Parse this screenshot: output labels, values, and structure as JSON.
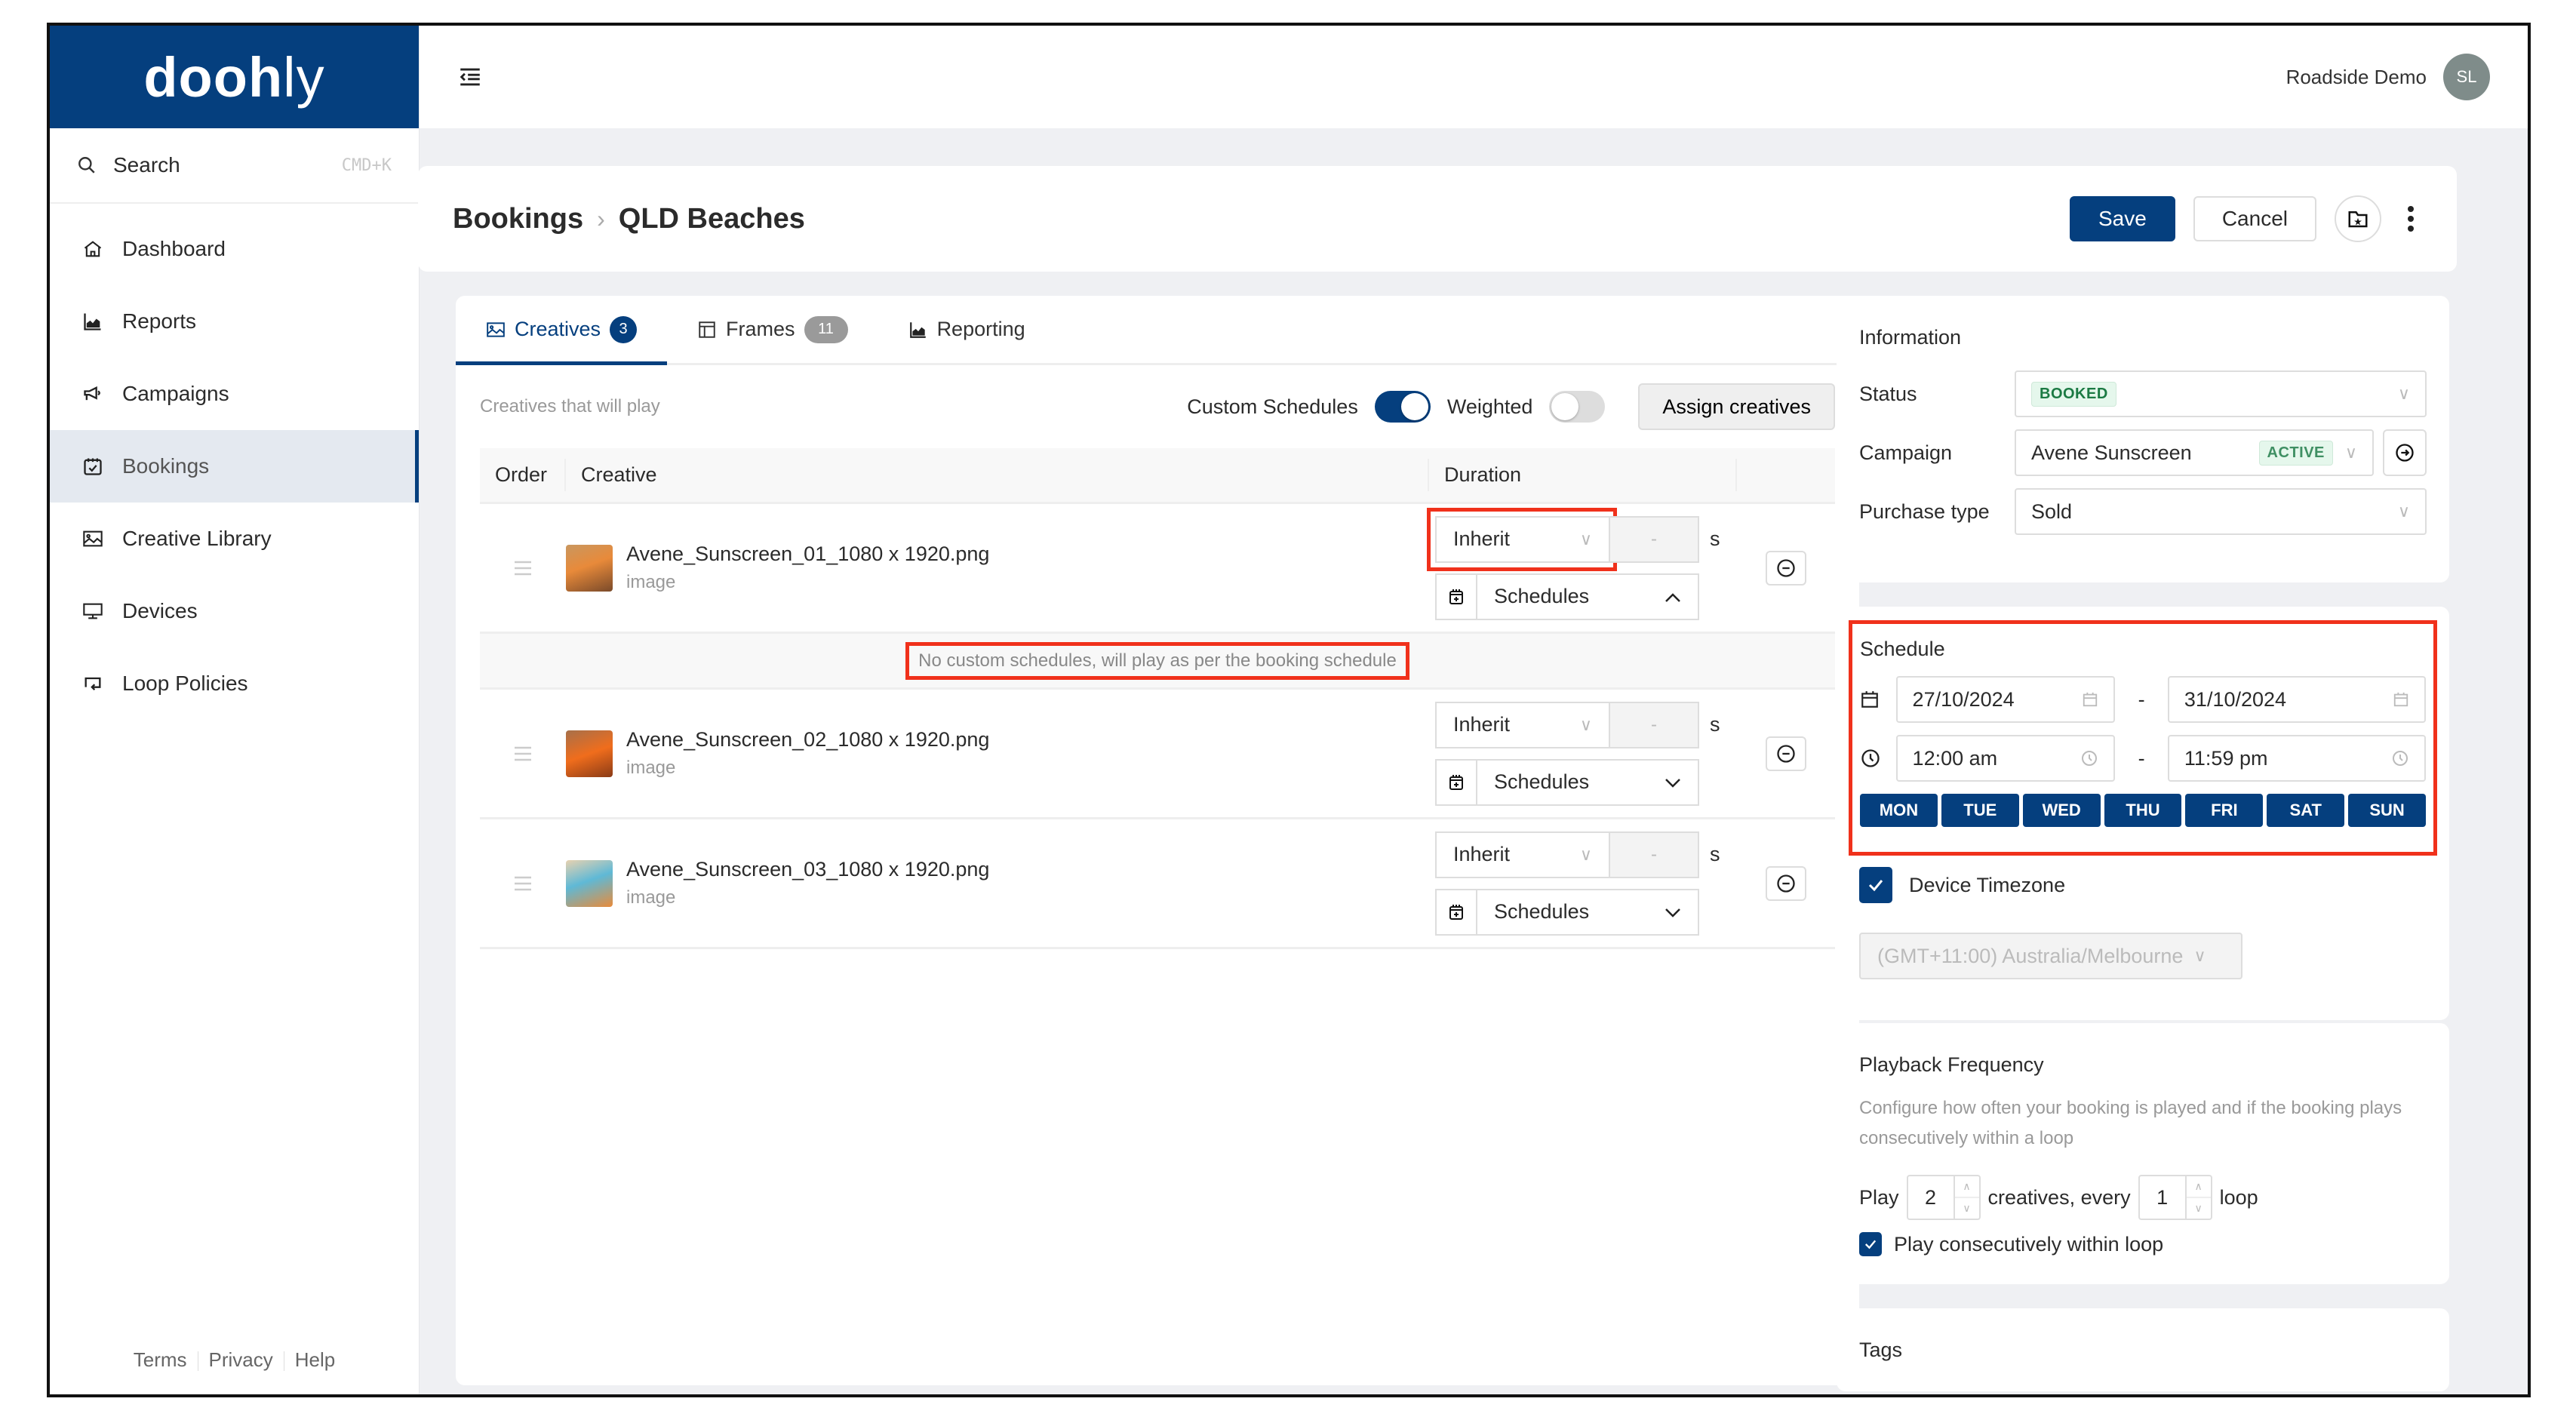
{
  "app": {
    "logo_bold": "dooh",
    "logo_light": "ly"
  },
  "sidebar": {
    "search": {
      "label": "Search",
      "shortcut": "CMD+K"
    },
    "items": [
      {
        "label": "Dashboard",
        "icon": "home-icon",
        "active": false
      },
      {
        "label": "Reports",
        "icon": "chart-icon",
        "active": false
      },
      {
        "label": "Campaigns",
        "icon": "megaphone-icon",
        "active": false
      },
      {
        "label": "Bookings",
        "icon": "calendar-check-icon",
        "active": true
      },
      {
        "label": "Creative Library",
        "icon": "image-icon",
        "active": false
      },
      {
        "label": "Devices",
        "icon": "monitor-icon",
        "active": false
      },
      {
        "label": "Loop Policies",
        "icon": "loop-icon",
        "active": false
      }
    ],
    "footer": {
      "terms": "Terms",
      "privacy": "Privacy",
      "help": "Help"
    }
  },
  "topbar": {
    "account_name": "Roadside Demo",
    "avatar_initials": "SL"
  },
  "header": {
    "breadcrumb": [
      "Bookings",
      "QLD Beaches"
    ],
    "save_label": "Save",
    "cancel_label": "Cancel"
  },
  "tabs": [
    {
      "label": "Creatives",
      "count": "3",
      "active": true
    },
    {
      "label": "Frames",
      "count": "11",
      "active": false
    },
    {
      "label": "Reporting",
      "count": null,
      "active": false
    }
  ],
  "creatives": {
    "hint": "Creatives that will play",
    "custom_schedules_label": "Custom Schedules",
    "custom_schedules_on": true,
    "weighted_label": "Weighted",
    "weighted_on": false,
    "assign_label": "Assign creatives",
    "columns": {
      "order": "Order",
      "creative": "Creative",
      "duration": "Duration"
    },
    "rows": [
      {
        "name": "Avene_Sunscreen_01_1080 x 1920.png",
        "type": "image",
        "duration_mode": "Inherit",
        "duration_value": "-",
        "unit": "s",
        "schedules_label": "Schedules",
        "expanded": true
      },
      {
        "name": "Avene_Sunscreen_02_1080 x 1920.png",
        "type": "image",
        "duration_mode": "Inherit",
        "duration_value": "-",
        "unit": "s",
        "schedules_label": "Schedules",
        "expanded": false
      },
      {
        "name": "Avene_Sunscreen_03_1080 x 1920.png",
        "type": "image",
        "duration_mode": "Inherit",
        "duration_value": "-",
        "unit": "s",
        "schedules_label": "Schedules",
        "expanded": false
      }
    ],
    "no_schedule_note": "No custom schedules, will play as per the booking schedule"
  },
  "information": {
    "title": "Information",
    "status_label": "Status",
    "status_value": "BOOKED",
    "campaign_label": "Campaign",
    "campaign_value": "Avene Sunscreen",
    "campaign_status": "ACTIVE",
    "purchase_type_label": "Purchase type",
    "purchase_type_value": "Sold"
  },
  "schedule": {
    "title": "Schedule",
    "start_date": "27/10/2024",
    "end_date": "31/10/2024",
    "start_time": "12:00 am",
    "end_time": "11:59 pm",
    "separator": "-",
    "days": [
      "MON",
      "TUE",
      "WED",
      "THU",
      "FRI",
      "SAT",
      "SUN"
    ],
    "device_timezone_label": "Device Timezone",
    "device_timezone_checked": true,
    "timezone_value": "(GMT+11:00) Australia/Melbourne"
  },
  "playback": {
    "title": "Playback Frequency",
    "description": "Configure how often your booking is played and if the booking plays consecutively within a loop",
    "play_label": "Play",
    "play_value": "2",
    "creatives_every_label": "creatives, every",
    "loop_value": "1",
    "loop_label": "loop",
    "consecutive_label": "Play consecutively within loop",
    "consecutive_checked": true
  },
  "tags": {
    "title": "Tags"
  },
  "colors": {
    "brand": "#053f7e",
    "highlight": "#f0311b",
    "tag_green": "#1b7a43"
  }
}
